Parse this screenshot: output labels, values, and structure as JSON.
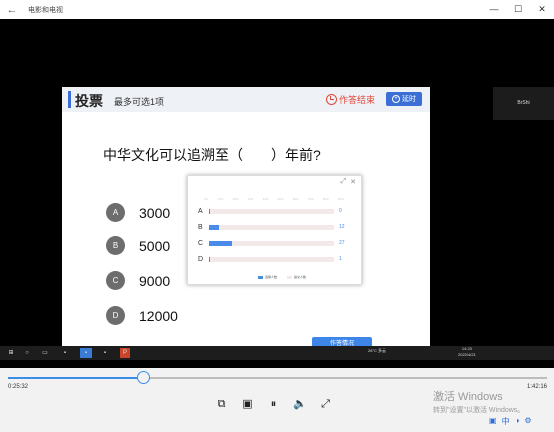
{
  "window": {
    "title": "电影和电视",
    "back_icon": "back-arrow-icon",
    "min": "—",
    "max": "☐",
    "close": "✕"
  },
  "participant": {
    "name": "BrShi"
  },
  "slide": {
    "title": "投票",
    "subtitle": "最多可选1项",
    "end_label": "作答结束",
    "extend_label": "延时",
    "question": "中华文化可以追溯至（　　）年前?",
    "options": [
      {
        "letter": "A",
        "value": "3000"
      },
      {
        "letter": "B",
        "value": "5000"
      },
      {
        "letter": "C",
        "value": "9000"
      },
      {
        "letter": "D",
        "value": "12000"
      }
    ],
    "submit_label": "作答情况"
  },
  "results": {
    "ticks": [
      "0%",
      "10%",
      "20%",
      "30%",
      "40%",
      "50%",
      "60%",
      "70%",
      "80%",
      "90%"
    ],
    "rows": [
      {
        "label": "A",
        "count": "0",
        "fraction": 0.005
      },
      {
        "label": "B",
        "count": "12",
        "fraction": 0.08
      },
      {
        "label": "C",
        "count": "27",
        "fraction": 0.18
      },
      {
        "label": "D",
        "count": "1",
        "fraction": 0.008
      }
    ],
    "legend": [
      "选择人数",
      "提交人数"
    ],
    "colors": {
      "bar": "#4a8ae8",
      "track": "#f3e9e9"
    }
  },
  "taskbar": {
    "weather": "28°C 多云",
    "time": "14:23",
    "date": "2022/4/21"
  },
  "player": {
    "current_time": "0:25:32",
    "total_time": "1:42:16",
    "progress": 0.25,
    "activation_title": "激活 Windows",
    "activation_sub": "转到\"设置\"以激活 Windows。",
    "lang": "中"
  }
}
